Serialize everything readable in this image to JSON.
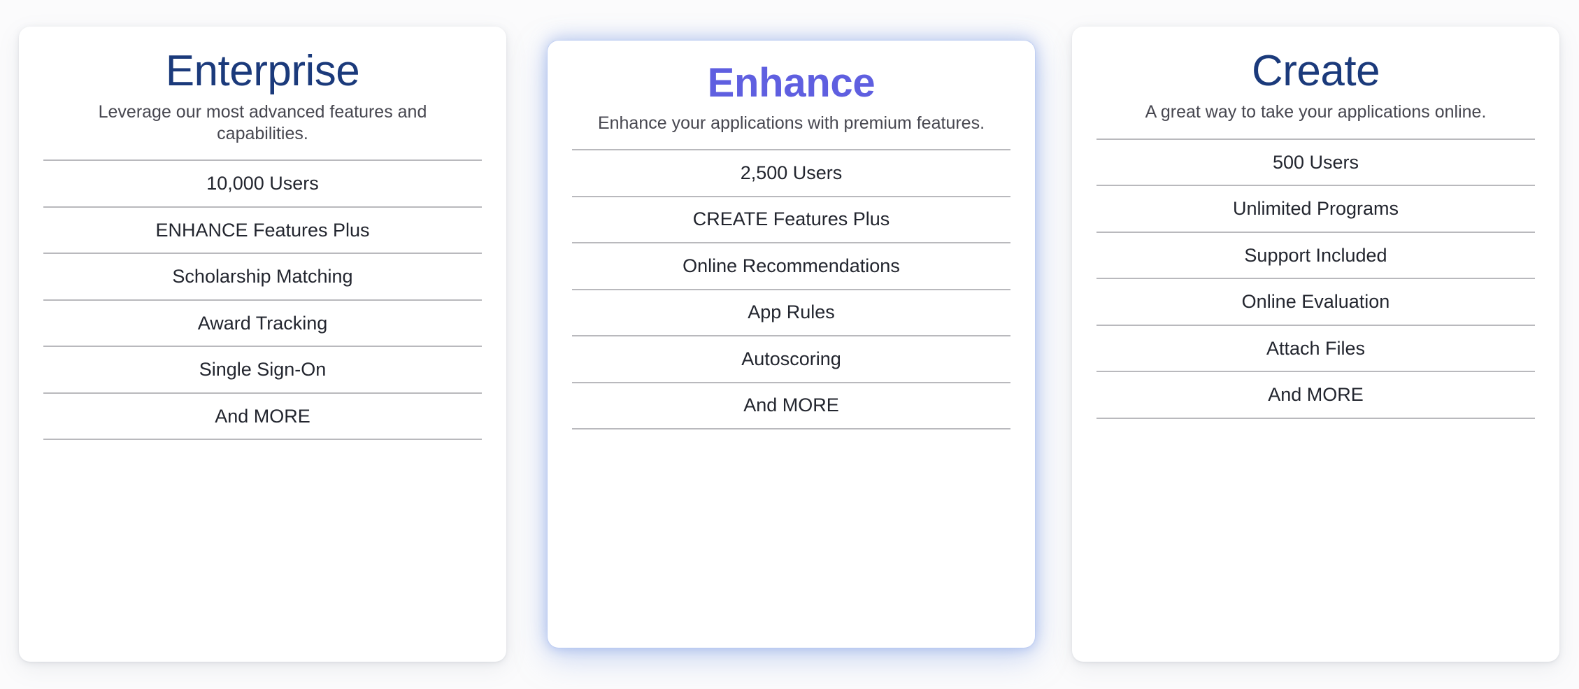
{
  "theme": {
    "page_background": "#fbfbfc",
    "card_background": "#ffffff",
    "standard_title_color": "#1b3a7b",
    "featured_title_color": "#5f5fe0",
    "tagline_color": "#474750",
    "feature_text_color": "#22252e",
    "divider_color": "#b9b9bd",
    "featured_glow_color": "#96b0ea"
  },
  "plans": [
    {
      "id": "enterprise",
      "title": "Enterprise",
      "tagline": "Leverage our most advanced features and capabilities.",
      "featured": false,
      "features": [
        "10,000 Users",
        "ENHANCE Features Plus",
        "Scholarship Matching",
        "Award Tracking",
        "Single Sign-On",
        "And MORE"
      ]
    },
    {
      "id": "enhance",
      "title": "Enhance",
      "tagline": "Enhance your applications with premium features.",
      "featured": true,
      "features": [
        "2,500 Users",
        "CREATE Features Plus",
        "Online Recommendations",
        "App Rules",
        "Autoscoring",
        "And MORE"
      ]
    },
    {
      "id": "create",
      "title": "Create",
      "tagline": "A great way to take your applications online.",
      "featured": false,
      "features": [
        "500 Users",
        "Unlimited Programs",
        "Support Included",
        "Online Evaluation",
        "Attach Files",
        "And MORE"
      ]
    }
  ]
}
